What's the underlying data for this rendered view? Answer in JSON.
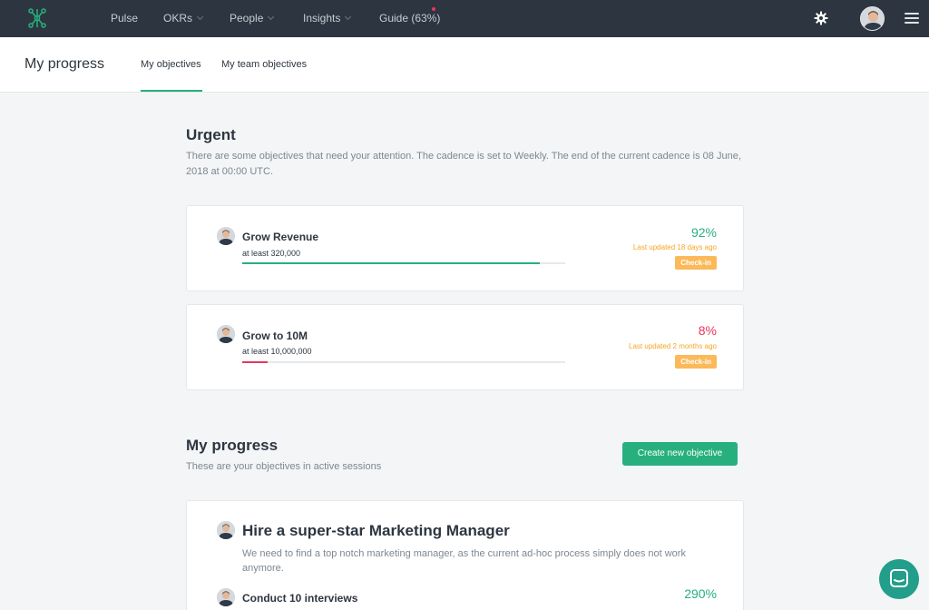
{
  "nav": {
    "items": [
      {
        "label": "Pulse",
        "has_dropdown": false
      },
      {
        "label": "OKRs",
        "has_dropdown": true
      },
      {
        "label": "People",
        "has_dropdown": true
      },
      {
        "label": "Insights",
        "has_dropdown": true
      },
      {
        "label": "Guide (63%)",
        "has_dropdown": false
      }
    ],
    "icons": {
      "logo": "logo-icon",
      "settings": "gear-icon",
      "menu": "hamburger-icon"
    },
    "colors": {
      "bar": "#2d3640",
      "notification_dot": "#e8365d"
    }
  },
  "subheader": {
    "title": "My progress",
    "tabs": [
      {
        "label": "My objectives",
        "active": true
      },
      {
        "label": "My team objectives",
        "active": false
      }
    ]
  },
  "urgent": {
    "title": "Urgent",
    "description": "There are some objectives that need your attention. The cadence is set to Weekly. The end of the current cadence is 08 June, 2018 at 00:00 UTC.",
    "objectives": [
      {
        "title": "Grow Revenue",
        "target": "at least 320,000",
        "progress_pct": "92%",
        "progress": 0.92,
        "updated": "Last updated 18 days ago",
        "action": "Check-in",
        "color": "#27b07e"
      },
      {
        "title": "Grow to 10M",
        "target": "at least 10,000,000",
        "progress_pct": "8%",
        "progress": 0.08,
        "updated": "Last updated 2 months ago",
        "action": "Check-in",
        "color": "#e8365d"
      }
    ]
  },
  "progress": {
    "title": "My progress",
    "description": "These are your objectives in active sessions",
    "create_label": "Create new objective",
    "objective": {
      "title": "Hire a super-star Marketing Manager",
      "description": "We need to find a top notch marketing manager, as the current ad-hoc process simply does not work anymore.",
      "key_result": {
        "title": "Conduct 10 interviews",
        "progress_pct": "290%"
      }
    }
  },
  "colors": {
    "accent": "#27b07e",
    "warning": "#f5a623",
    "danger": "#e8365d"
  }
}
